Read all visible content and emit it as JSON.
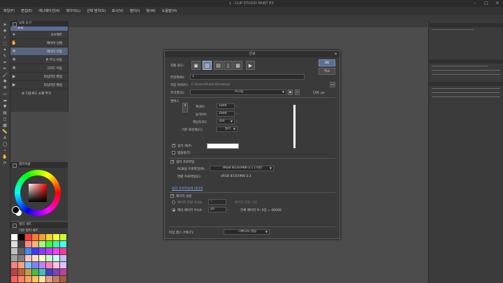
{
  "window": {
    "title": "1 - CLIP STUDIO PAINT EX",
    "controls": [
      "–",
      "□",
      "✕"
    ]
  },
  "menu": [
    "파일(F)",
    "편집(E)",
    "애니메이션(A)",
    "레이어(L)",
    "선택 범위(S)",
    "표시(V)",
    "필터(I)",
    "창(W)",
    "도움말(H)"
  ],
  "subtool": {
    "title": "보조 도구",
    "selected": "조작",
    "items": [
      {
        "label": "오브젝트",
        "icon": "arrow-icon"
      },
      {
        "label": "레이어 선택",
        "icon": "hand-icon"
      },
      {
        "label": "레이어 이동",
        "icon": "move-icon",
        "active": true
      },
      {
        "label": "톤 무늬 이동",
        "icon": "move-icon"
      },
      {
        "label": "그리드 이동",
        "icon": "move-icon"
      },
      {
        "label": "타임라인 편집",
        "icon": "timeline-icon"
      },
      {
        "label": "타임라인 편집",
        "icon": "timeline-icon"
      }
    ],
    "add_label": "다운로드 소재 추가"
  },
  "color_panel": {
    "title": "컬러서클"
  },
  "swatch_panel": {
    "title": "컬러 세트",
    "subtitle": "기본 컬러 세트",
    "colors": [
      "#ffffff",
      "#000000",
      "#ff3b3b",
      "#ff7a2e",
      "#ff9a2e",
      "#ffd02e",
      "#ffff3b",
      "#c8ff2e",
      "#e0e0e0",
      "#404040",
      "#ff8a8a",
      "#ffb07a",
      "#a0ff7a",
      "#3bff3b",
      "#3bffa0",
      "#3bffff",
      "#c0c0c0",
      "#606060",
      "#3b8aff",
      "#3b3bff",
      "#8a3bff",
      "#c03bff",
      "#ff3bff",
      "#ff3b8a",
      "#a0a0a0",
      "#808080",
      "#ffc0c0",
      "#ffe0c0",
      "#ffffc0",
      "#c0ffc0",
      "#c0ffff",
      "#c0c0ff",
      "#ff8080",
      "#ffa080",
      "#80c0ff",
      "#8080ff",
      "#c080ff",
      "#ff80c0",
      "#ffc0e0",
      "#e0c0ff",
      "#c04040",
      "#c06040",
      "#c0a040",
      "#40c040",
      "#40c0c0",
      "#4040c0",
      "#8040c0",
      "#c040a0",
      "#ff6060",
      "#ff8060",
      "#ffa060",
      "#ffc060",
      "#ffe0a0",
      "#e0a080",
      "#c08060",
      "#a06040"
    ]
  },
  "dialog": {
    "title": "신규",
    "close": "✕",
    "ok": "OK",
    "cancel": "취소",
    "purpose_label": "작품 용도:",
    "purposes": [
      "illustration-icon",
      "comic-icon",
      "book-icon",
      "webtoon-icon",
      "print-icon",
      "animation-icon"
    ],
    "filename_label": "파일명(N):",
    "filename_value": "1",
    "path_label": "저장 위치(F):",
    "path_value": "C:\\Users\\Public\\Desktop\\",
    "preset_label": "프리셋(S):",
    "preset_value": "커스텀",
    "unit_label": "단위: px",
    "canvas_section": "캔버스",
    "width_label": "폭(W):",
    "width_value": "1000",
    "height_label": "높이(H):",
    "height_value": "2000",
    "dpi_label": "해상도(R):",
    "dpi_value": "350",
    "base_color_label": "기본 표현색(C):",
    "base_color_value": "컬러",
    "paper_color_label": "용지 색(P)",
    "template_label": "템플릿(T)",
    "color_profile_label": "컬러 프로파일",
    "rgb_profile_label": "RGB용 프로파일(R):",
    "rgb_profile_value": "sRGB IEC61966-2.1 (기본)",
    "cmyk_profile_label": "변환 프로파일(E):",
    "cmyk_profile_value": "sRGB IEC61966-2.1",
    "profile_link": "컬러 프로파일에 대하여",
    "page_setting_label": "페이지 설정",
    "frames_label": "페이지 분할 수(D):",
    "frames_value": "0",
    "frames_hint": "페이지 분할: 0장",
    "pages_label": "매의 페이지 수(U):",
    "pages_value": "20",
    "pages_hint": "전체 페이지 수: 0장 = 40000",
    "timelapse_label": "타임 랩스 기록(T):",
    "timelapse_value": "기록하지 않음"
  }
}
